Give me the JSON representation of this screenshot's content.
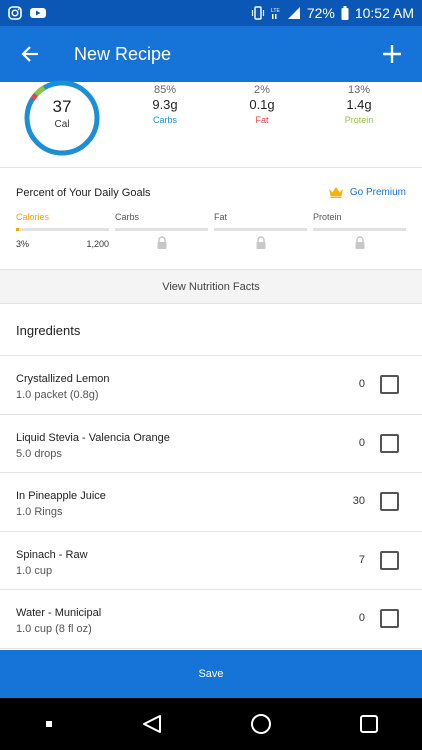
{
  "status_bar": {
    "battery": "72%",
    "time": "10:52 AM",
    "icons": [
      "instagram-icon",
      "youtube-icon",
      "vibrate-icon",
      "lte-signal-icon",
      "signal-icon",
      "battery-icon"
    ]
  },
  "app_bar": {
    "title": "New Recipe",
    "icons": [
      "back-arrow-icon",
      "plus-icon"
    ]
  },
  "calories": {
    "value": "37",
    "label": "Cal",
    "ring_colors": {
      "carbs": "#1a8fd8",
      "fat": "#e8453c",
      "protein": "#8cc63f"
    }
  },
  "macros": [
    {
      "percent": "85%",
      "grams": "9.3g",
      "name": "Carbs",
      "color": "#1a8fd8"
    },
    {
      "percent": "2%",
      "grams": "0.1g",
      "name": "Fat",
      "color": "#e8453c"
    },
    {
      "percent": "13%",
      "grams": "1.4g",
      "name": "Protein",
      "color": "#8cc63f"
    }
  ],
  "goals": {
    "title": "Percent of Your Daily Goals",
    "premium_label": "Go Premium",
    "columns": [
      {
        "label": "Calories",
        "percent": "3%",
        "goal": "1,200",
        "fill": 0.03,
        "locked": false
      },
      {
        "label": "Carbs",
        "locked": true
      },
      {
        "label": "Fat",
        "locked": true
      },
      {
        "label": "Protein",
        "locked": true
      }
    ]
  },
  "nutrition_facts_label": "View Nutrition Facts",
  "ingredients_title": "Ingredients",
  "ingredients": [
    {
      "name": "Crystallized Lemon",
      "amount": "1.0 packet   (0.8g)",
      "calories": "0"
    },
    {
      "name": "Liquid Stevia - Valencia Orange",
      "amount": "5.0 drops",
      "calories": "0"
    },
    {
      "name": "In Pineapple Juice",
      "amount": "1.0 Rings",
      "calories": "30"
    },
    {
      "name": "Spinach - Raw",
      "amount": "1.0 cup",
      "calories": "7"
    },
    {
      "name": "Water - Municipal",
      "amount": "1.0 cup (8 fl oz)",
      "calories": "0"
    }
  ],
  "save_label": "Save",
  "nav_bar": {
    "icons": [
      "recents-square-icon",
      "back-triangle-icon",
      "home-circle-icon",
      "overview-square-icon"
    ]
  }
}
